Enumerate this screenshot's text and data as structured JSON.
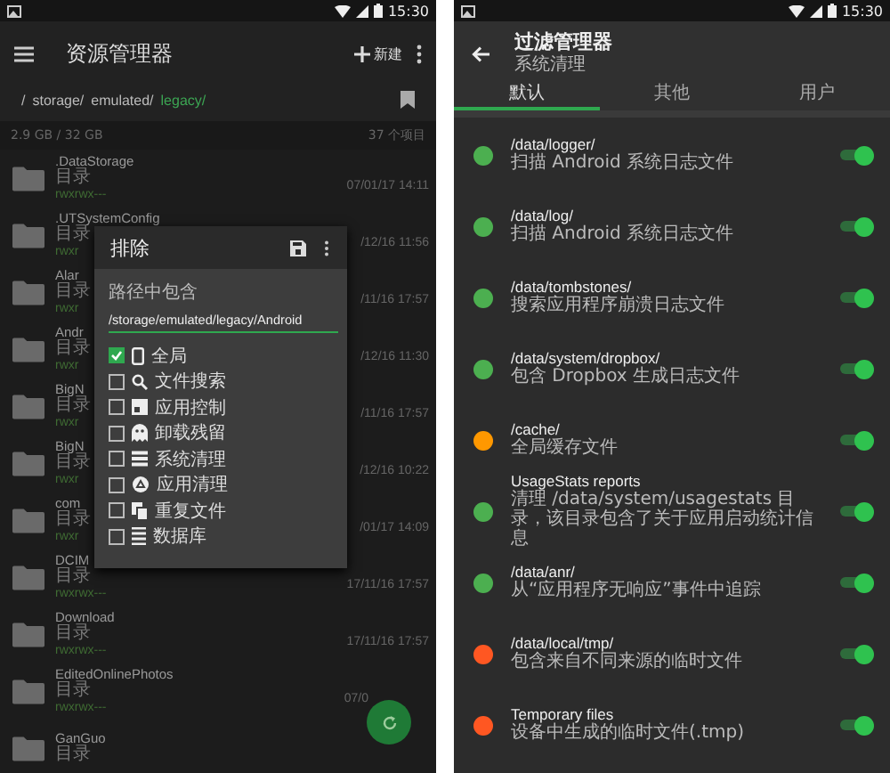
{
  "left_screen": {
    "status_bar": {
      "time": "15:30"
    },
    "toolbar": {
      "title": "资源管理器",
      "new_button": "新建"
    },
    "breadcrumb": [
      {
        "label": "/",
        "selected": false
      },
      {
        "label": "storage/",
        "selected": false
      },
      {
        "label": "emulated/",
        "selected": false
      },
      {
        "label": "legacy/",
        "selected": true
      }
    ],
    "storage": {
      "usage": "2.9 GB / 32 GB",
      "count": "37 个项目"
    },
    "files": [
      {
        "name": ".DataStorage",
        "type": "目录",
        "permissions": "rwxrwx---",
        "date": "07/01/17 14:11"
      },
      {
        "name": ".UTSystemConfig",
        "type": "目录",
        "permissions": "rwxr",
        "date": "/12/16 11:56"
      },
      {
        "name": "Alar",
        "type": "目录",
        "permissions": "rwxr",
        "date": "/11/16 17:57"
      },
      {
        "name": "Andr",
        "type": "目录",
        "permissions": "rwxr",
        "date": "/12/16 11:30"
      },
      {
        "name": "BigN",
        "type": "目录",
        "permissions": "rwxr",
        "date": "/11/16 17:57"
      },
      {
        "name": "BigN",
        "type": "目录",
        "permissions": "rwxr",
        "date": "/12/16 10:22"
      },
      {
        "name": "com",
        "type": "目录",
        "permissions": "rwxr",
        "date": "/01/17 14:09"
      },
      {
        "name": "DCIM",
        "type": "目录",
        "permissions": "rwxrwx---",
        "date": "17/11/16 17:57"
      },
      {
        "name": "Download",
        "type": "目录",
        "permissions": "rwxrwx---",
        "date": "17/11/16 17:57"
      },
      {
        "name": "EditedOnlinePhotos",
        "type": "目录",
        "permissions": "rwxrwx---",
        "date": "07/0"
      },
      {
        "name": "GanGuo",
        "type": "目录"
      }
    ],
    "dialog": {
      "title": "排除",
      "field_label": "路径中包含",
      "field_value": "/storage/emulated/legacy/Android",
      "options": [
        {
          "label": "全局",
          "checked": true,
          "kind": "phone"
        },
        {
          "label": "文件搜索",
          "checked": false,
          "kind": "search"
        },
        {
          "label": "应用控制",
          "checked": false,
          "kind": "app"
        },
        {
          "label": "卸载残留",
          "checked": false,
          "kind": "ghost"
        },
        {
          "label": "系统清理",
          "checked": false,
          "kind": "list"
        },
        {
          "label": "应用清理",
          "checked": false,
          "kind": "recycle"
        },
        {
          "label": "重复文件",
          "checked": false,
          "kind": "copy"
        },
        {
          "label": "数据库",
          "checked": false,
          "kind": "database"
        }
      ]
    }
  },
  "right_screen": {
    "status_bar": {
      "time": "15:30"
    },
    "header": {
      "title": "过滤管理器",
      "subtitle": "系统清理"
    },
    "tabs": [
      {
        "label": "默认",
        "selected": true
      },
      {
        "label": "其他",
        "selected": false
      },
      {
        "label": "用户",
        "selected": false
      }
    ],
    "filters": [
      {
        "title": "/data/logger/",
        "description": "扫描 Android 系统日志文件",
        "color": "#4caf50",
        "on": true
      },
      {
        "title": "/data/log/",
        "description": "扫描 Android 系统日志文件",
        "color": "#4caf50",
        "on": true
      },
      {
        "title": "/data/tombstones/",
        "description": "搜索应用程序崩溃日志文件",
        "color": "#4caf50",
        "on": true
      },
      {
        "title": "/data/system/dropbox/",
        "description": "包含 Dropbox 生成日志文件",
        "color": "#4caf50",
        "on": true
      },
      {
        "title": "/cache/",
        "description": "全局缓存文件",
        "color": "#ff9800",
        "on": true
      },
      {
        "title": "UsageStats reports",
        "description": "清理 /data/system/usagestats 目录，该目录包含了关于应用启动统计信息",
        "color": "#4caf50",
        "on": true
      },
      {
        "title": "/data/anr/",
        "description": "从“应用程序无响应”事件中追踪",
        "color": "#4caf50",
        "on": true
      },
      {
        "title": "/data/local/tmp/",
        "description": "包含来自不同来源的临时文件",
        "color": "#ff5722",
        "on": true
      },
      {
        "title": "Temporary files",
        "description": "设备中生成的临时文件(.tmp)",
        "color": "#ff5722",
        "on": true
      }
    ]
  }
}
